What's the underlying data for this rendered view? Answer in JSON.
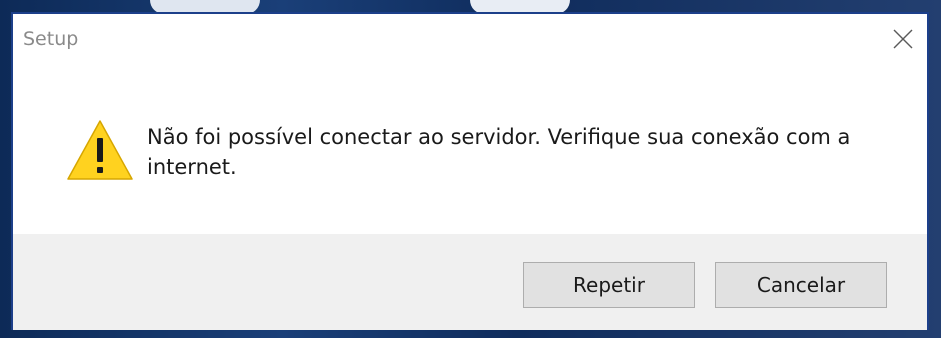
{
  "window": {
    "title": "Setup"
  },
  "message": {
    "text": "Não foi possível conectar ao servidor. Verifique sua conexão com a internet.",
    "icon": "warning-icon"
  },
  "buttons": {
    "retry_label": "Repetir",
    "cancel_label": "Cancelar"
  },
  "icons": {
    "close": "close-icon"
  },
  "colors": {
    "warning_fill": "#ffd21f",
    "dialog_border": "#1c3f8a",
    "footer_bg": "#f0f0f0",
    "button_bg": "#e1e1e1"
  }
}
